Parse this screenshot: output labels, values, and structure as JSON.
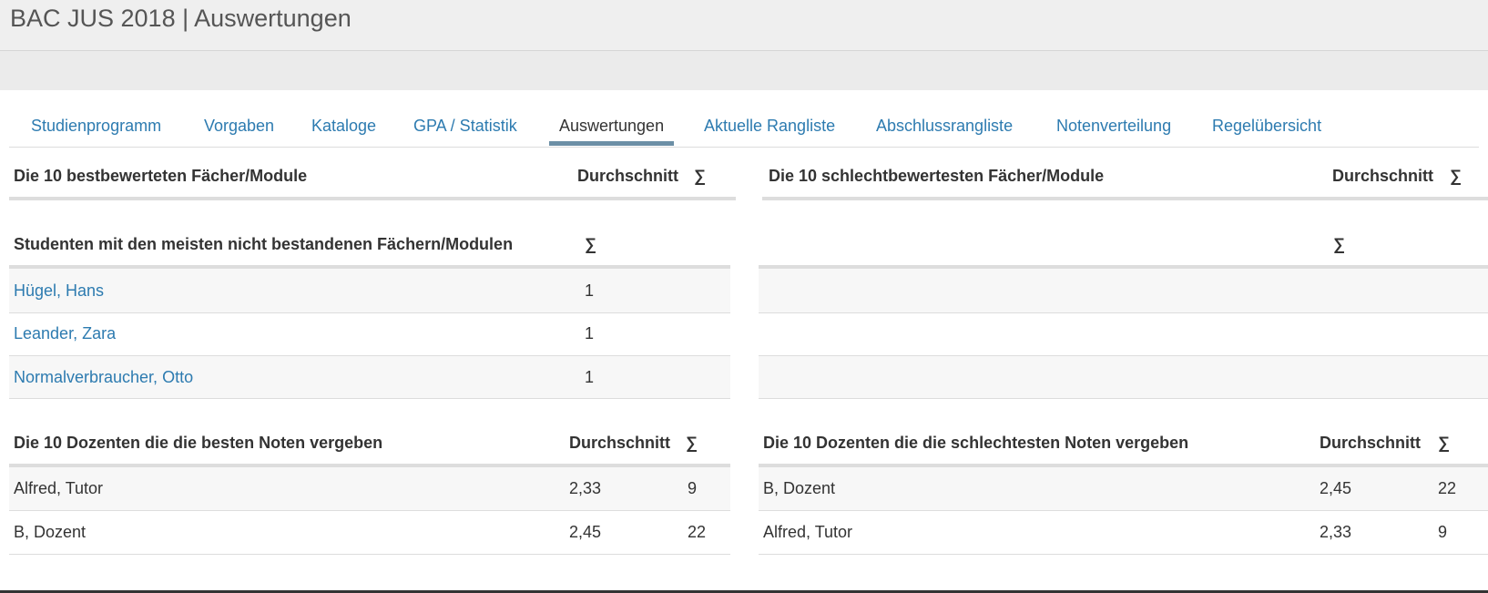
{
  "header": {
    "title": "BAC JUS 2018 | Auswertungen"
  },
  "tabs": [
    {
      "label": "Studienprogramm",
      "active": false
    },
    {
      "label": "Vorgaben",
      "active": false
    },
    {
      "label": "Kataloge",
      "active": false
    },
    {
      "label": "GPA / Statistik",
      "active": false
    },
    {
      "label": "Auswertungen",
      "active": true
    },
    {
      "label": "Aktuelle Rangliste",
      "active": false
    },
    {
      "label": "Abschlussrangliste",
      "active": false
    },
    {
      "label": "Notenverteilung",
      "active": false
    },
    {
      "label": "Regelübersicht",
      "active": false
    }
  ],
  "best_subjects": {
    "title": "Die 10 bestbewerteten Fächer/Module",
    "col_avg": "Durchschnitt",
    "col_sum": "∑",
    "rows": []
  },
  "worst_subjects": {
    "title": "Die 10 schlechtbewertesten Fächer/Module",
    "col_avg": "Durchschnitt",
    "col_sum": "∑",
    "rows": []
  },
  "failed_students": {
    "title": "Studenten mit den meisten nicht bestandenen Fächern/Modulen",
    "col_sum": "∑",
    "right_col_sum": "∑",
    "rows": [
      {
        "name": "Hügel, Hans",
        "count": "1"
      },
      {
        "name": "Leander, Zara",
        "count": "1"
      },
      {
        "name": "Normalverbraucher, Otto",
        "count": "1"
      }
    ]
  },
  "best_lecturers": {
    "title": "Die 10 Dozenten die die besten Noten vergeben",
    "col_avg": "Durchschnitt",
    "col_sum": "∑",
    "rows": [
      {
        "name": "Alfred, Tutor",
        "avg": "2,33",
        "sum": "9"
      },
      {
        "name": "B, Dozent",
        "avg": "2,45",
        "sum": "22"
      }
    ]
  },
  "worst_lecturers": {
    "title": "Die 10 Dozenten die die schlechtesten Noten vergeben",
    "col_avg": "Durchschnitt",
    "col_sum": "∑",
    "rows": [
      {
        "name": "B, Dozent",
        "avg": "2,45",
        "sum": "22"
      },
      {
        "name": "Alfred, Tutor",
        "avg": "2,33",
        "sum": "9"
      }
    ]
  }
}
